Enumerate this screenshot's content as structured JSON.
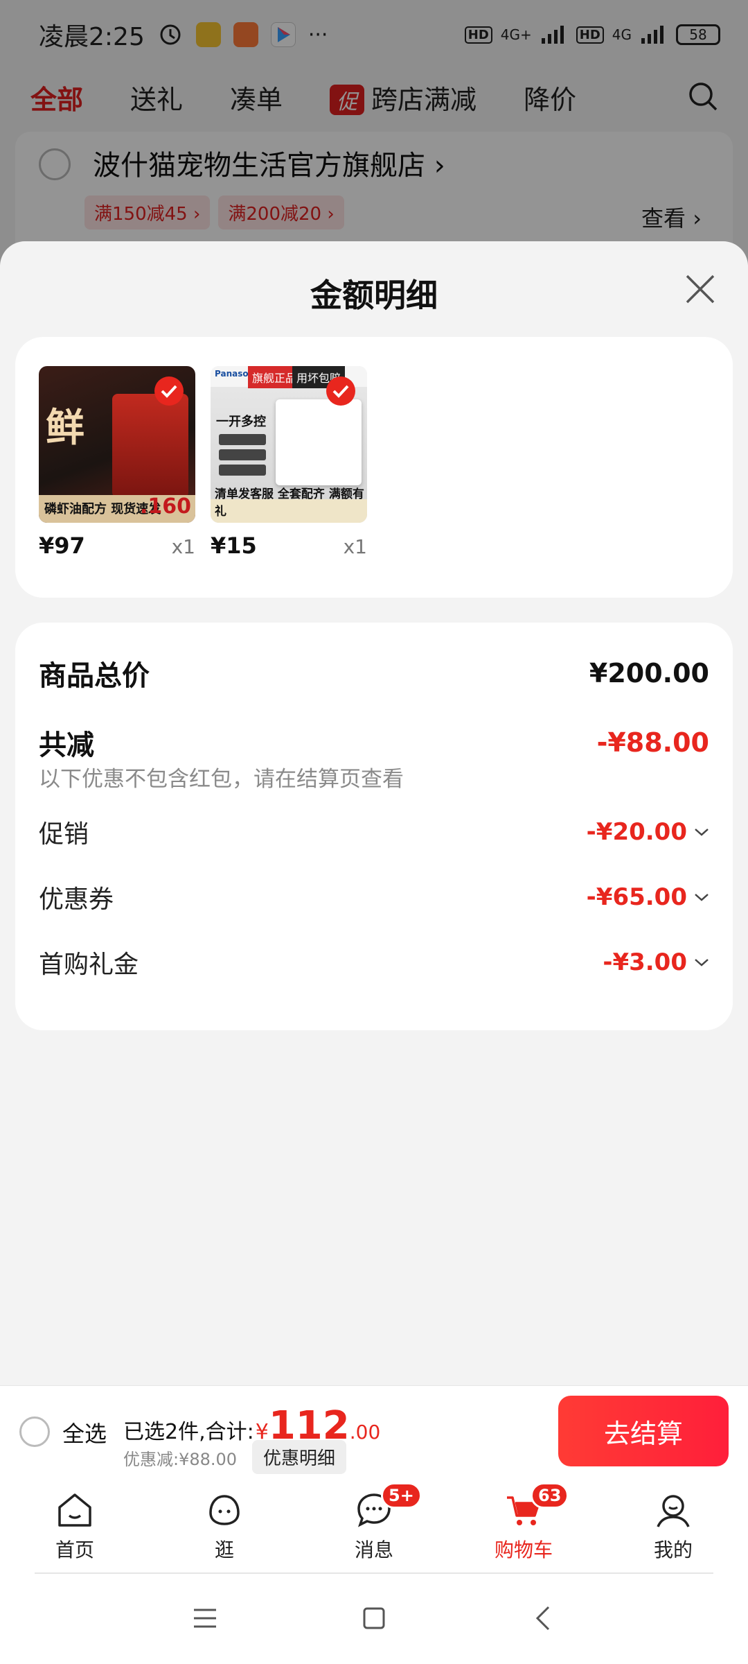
{
  "status_bar": {
    "time": "凌晨2:25",
    "more": "···",
    "net1": "4G+",
    "net2": "4G",
    "hd": "HD",
    "battery": "58"
  },
  "background": {
    "tabs": [
      "全部",
      "送礼",
      "凑单",
      "跨店满减",
      "降价"
    ],
    "promo_tag": "促",
    "store_name": "波什猫宠物生活官方旗舰店",
    "coupons": [
      "满150减45",
      "满200减20"
    ],
    "view": "查看"
  },
  "sheet": {
    "title": "金额明细",
    "products": [
      {
        "price": "¥97",
        "qty": "x1",
        "thumb_big": "鲜",
        "thumb_bar": "磷虾油配方 现货速发",
        "thumb_price": ".160"
      },
      {
        "price": "¥15",
        "qty": "x1",
        "thumb_brand": "Panasonic",
        "thumb_flag": "旗舰正品",
        "thumb_flag2": "用坏包赔",
        "thumb_text": "一开多控",
        "thumb_bar": "清单发客服 全套配齐 满额有礼"
      }
    ],
    "summary": {
      "total_label": "商品总价",
      "total_value": "¥200.00",
      "reduce_label": "共减",
      "reduce_value": "-¥88.00",
      "note": "以下优惠不包含红包，请在结算页查看",
      "items": [
        {
          "label": "促销",
          "value": "-¥20.00"
        },
        {
          "label": "优惠券",
          "value": "-¥65.00"
        },
        {
          "label": "首购礼金",
          "value": "-¥3.00"
        }
      ]
    }
  },
  "checkout": {
    "select_all": "全选",
    "selected_text": "已选2件,合计:",
    "currency": "¥",
    "amount": "112",
    "decimals": ".00",
    "discount": "优惠减:¥88.00",
    "detail_button": "优惠明细",
    "go_button": "去结算"
  },
  "nav": {
    "items": [
      {
        "label": "首页"
      },
      {
        "label": "逛"
      },
      {
        "label": "消息",
        "badge": "5+"
      },
      {
        "label": "购物车",
        "badge": "63"
      },
      {
        "label": "我的"
      }
    ]
  },
  "colors": {
    "accent": "#e8261e",
    "sheet_bg": "#f3f3f3"
  }
}
